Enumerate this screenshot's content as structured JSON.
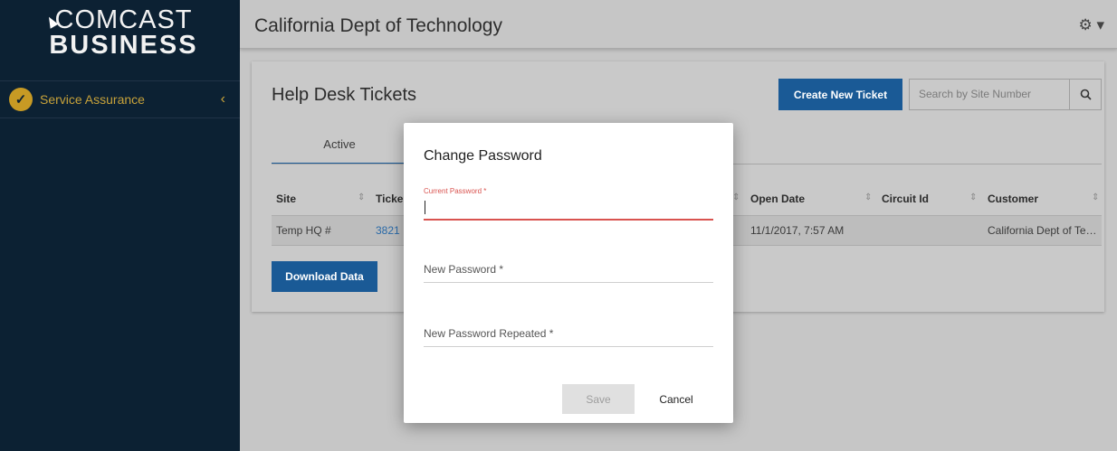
{
  "brand": {
    "line1": "COMCAST",
    "line2": "BUSINESS"
  },
  "sidebar": {
    "items": [
      {
        "label": "Service Assurance",
        "icon": "check-circle-icon",
        "chevron": "‹"
      }
    ]
  },
  "header": {
    "title": "California Dept of Technology",
    "settings_icon": "gear-icon"
  },
  "main": {
    "title": "Help Desk Tickets",
    "create_button": "Create New Ticket",
    "search": {
      "placeholder": "Search by Site Number",
      "icon": "search-icon"
    },
    "tabs": [
      {
        "label": "Active"
      }
    ],
    "table": {
      "columns": [
        "Site",
        "Ticke",
        "Open Date",
        "Circuit Id",
        "Customer"
      ],
      "rows": [
        [
          "Temp HQ #",
          "3821",
          "11/1/2017, 7:57 AM",
          "",
          "California Dept of Te…"
        ]
      ]
    },
    "download_button": "Download Data"
  },
  "modal": {
    "title": "Change Password",
    "fields": [
      {
        "label": "Current Password *",
        "value": ""
      },
      {
        "label": "New Password *",
        "value": ""
      },
      {
        "label": "New Password Repeated *",
        "value": ""
      }
    ],
    "save_label": "Save",
    "cancel_label": "Cancel"
  },
  "colors": {
    "sidebar_bg": "#0c2133",
    "accent_gold": "#c7a23a",
    "primary_blue": "#1a5a96",
    "error_red": "#d9534f"
  }
}
